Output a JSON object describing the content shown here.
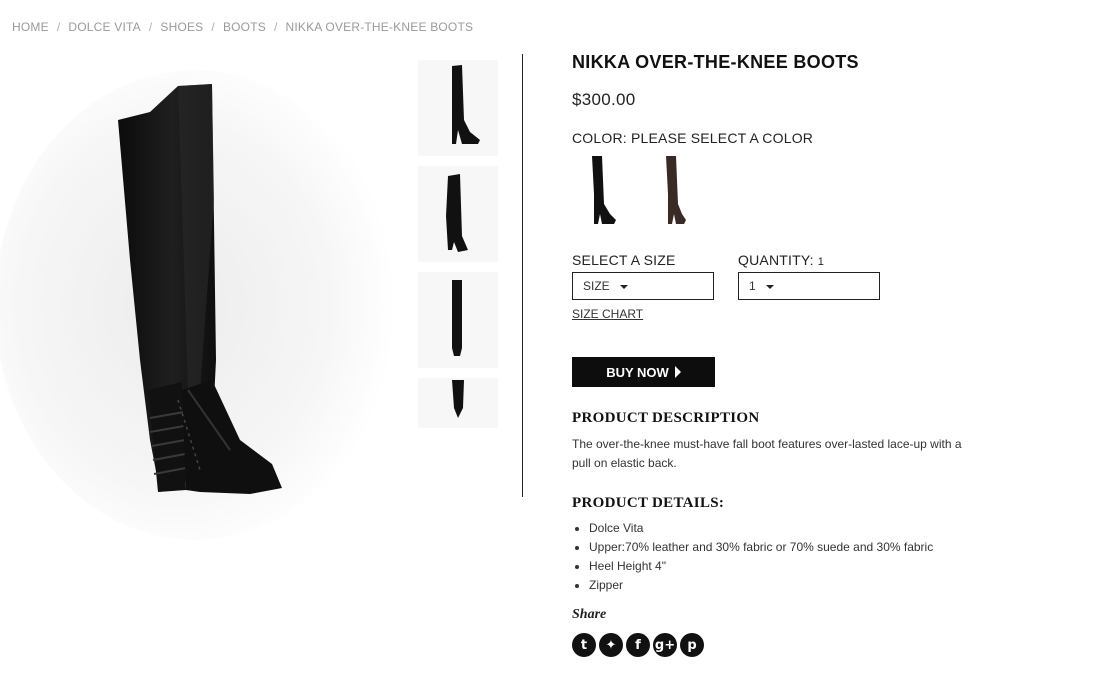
{
  "breadcrumb": [
    "HOME",
    "DOLCE VITA",
    "SHOES",
    "BOOTS",
    "NIKKA OVER-THE-KNEE BOOTS"
  ],
  "product": {
    "title": "NIKKA OVER-THE-KNEE BOOTS",
    "price": "$300.00",
    "color_label": "COLOR: PLEASE SELECT A COLOR",
    "swatches": [
      {
        "name": "black",
        "color": "#1a1a1a"
      },
      {
        "name": "brown",
        "color": "#3a2a24"
      }
    ]
  },
  "size": {
    "label": "SELECT A SIZE",
    "value": "SIZE"
  },
  "quantity": {
    "label": "QUANTITY:",
    "label_value": "1",
    "value": "1"
  },
  "size_chart": "SIZE CHART",
  "buy_now": "BUY NOW",
  "description": {
    "heading": "PRODUCT DESCRIPTION",
    "text": "The over-the-knee must-have fall boot features over-lasted lace-up with a pull on elastic back."
  },
  "details": {
    "heading": "PRODUCT DETAILS:",
    "items": [
      "Dolce Vita",
      "Upper:70% leather and 30% fabric or 70% suede and 30% fabric",
      "Heel Height 4\"",
      "Zipper"
    ]
  },
  "share": {
    "label": "Share",
    "icons": [
      {
        "name": "tumblr-icon",
        "glyph": "t"
      },
      {
        "name": "twitter-icon",
        "glyph": "✦"
      },
      {
        "name": "facebook-icon",
        "glyph": "f"
      },
      {
        "name": "google-plus-icon",
        "glyph": "g+"
      },
      {
        "name": "pinterest-icon",
        "glyph": "p"
      }
    ]
  },
  "colors": {
    "accent": "#0d0d0d",
    "muted": "#9a9a9a"
  }
}
